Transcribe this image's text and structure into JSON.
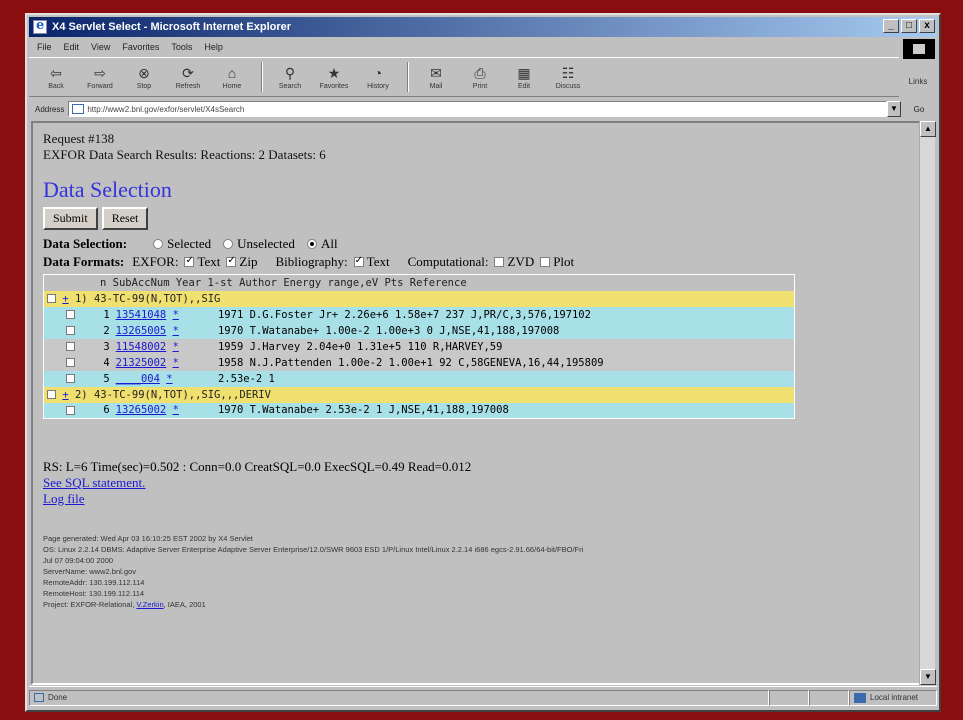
{
  "window": {
    "title": "X4 Servlet Select - Microsoft Internet Explorer",
    "min": "_",
    "max": "□",
    "close": "x"
  },
  "menu": [
    "File",
    "Edit",
    "View",
    "Favorites",
    "Tools",
    "Help"
  ],
  "toolbar": [
    {
      "label": "Back",
      "icon": "back-arrow-icon"
    },
    {
      "label": "Forward",
      "icon": "forward-arrow-icon"
    },
    {
      "label": "Stop",
      "icon": "stop-icon"
    },
    {
      "label": "Refresh",
      "icon": "refresh-icon"
    },
    {
      "label": "Home",
      "icon": "home-icon"
    },
    {
      "label": "Search",
      "icon": "search-icon"
    },
    {
      "label": "Favorites",
      "icon": "favorites-icon"
    },
    {
      "label": "History",
      "icon": "history-icon"
    },
    {
      "label": "Mail",
      "icon": "mail-icon"
    },
    {
      "label": "Print",
      "icon": "print-icon"
    },
    {
      "label": "Edit",
      "icon": "edit-icon"
    },
    {
      "label": "Discuss",
      "icon": "discuss-icon"
    }
  ],
  "links_label": "Links",
  "address": {
    "label": "Address",
    "url": "http://www2.bnl.gov/exfor/servlet/X4sSearch",
    "go": "Go"
  },
  "page": {
    "request": "Request #138",
    "summary": "EXFOR Data Search Results: Reactions: 2 Datasets: 6",
    "heading": "Data Selection",
    "submit": "Submit",
    "reset": "Reset",
    "sel_label": "Data Selection:",
    "sel_options": [
      "Selected",
      "Unselected",
      "All"
    ],
    "fmt_label": "Data Formats:",
    "exfor_label": "EXFOR:",
    "text1": "Text",
    "zip": "Zip",
    "biblio_label": "Bibliography:",
    "text2": "Text",
    "comp_label": "Computational:",
    "zvd": "ZVD",
    "plot": "Plot",
    "table_header": "n SubAccNum Year 1-st Author      Energy range,eV Pts Reference",
    "groups": [
      {
        "label": "1) 43-TC-99(N,TOT),,SIG",
        "rows": [
          {
            "n": "1",
            "acc": "13541048",
            "star": "*",
            "info": "1971 D.G.Foster Jr+  2.26e+6 1.58e+7 237 J,PR/C,3,576,197102"
          },
          {
            "n": "2",
            "acc": "13265005",
            "star": "*",
            "info": "1970 T.Watanabe+      1.00e-2 1.00e+3 0   J,NSE,41,188,197008"
          },
          {
            "n": "3",
            "acc": "11548002",
            "star": "*",
            "info": "1959 J.Harvey          2.04e+0 1.31e+5 110 R,HARVEY,59"
          },
          {
            "n": "4",
            "acc": "21325002",
            "star": "*",
            "info": "1958 N.J.Pattenden     1.00e-2 1.00e+1 92  C,58GENEVA,16,44,195809"
          },
          {
            "n": "5",
            "acc": "____004",
            "star": "*",
            "info": "                            2.53e-2 1"
          }
        ]
      },
      {
        "label": "2) 43-TC-99(N,TOT),,SIG,,,DERIV",
        "rows": [
          {
            "n": "6",
            "acc": "13265002",
            "star": "*",
            "info": "1970 T.Watanabe+              2.53e-2 1   J,NSE,41,188,197008"
          }
        ]
      }
    ],
    "stats": "RS: L=6 Time(sec)=0.502 : Conn=0.0 CreatSQL=0.0 ExecSQL=0.49 Read=0.012",
    "sql_link": "See SQL statement.",
    "log_link": "Log file",
    "footer": [
      "Page generated: Wed Apr 03 16:10:25 EST 2002 by X4 Servlet",
      "OS: Linux 2.2.14 DBMS: Adaptive Server Enterprise Adaptive Server Enterprise/12.0/SWR 9603 ESD 1/P/Linux Intel/Linux 2.2.14 i686 egcs-2.91.66/64-bit/FBO/Fri",
      "Jul 07 09:04:00 2000",
      "ServerName: www2.bnl.gov",
      "RemoteAddr: 130.199.112.114",
      "RemoteHost: 130.199.112.114"
    ],
    "project_prefix": "Project: EXFOR-Relational,",
    "project_author": "V.Zerkin",
    "project_suffix": ", IAEA, 2001"
  },
  "status": {
    "left": "Done",
    "zone": "Local intranet"
  }
}
